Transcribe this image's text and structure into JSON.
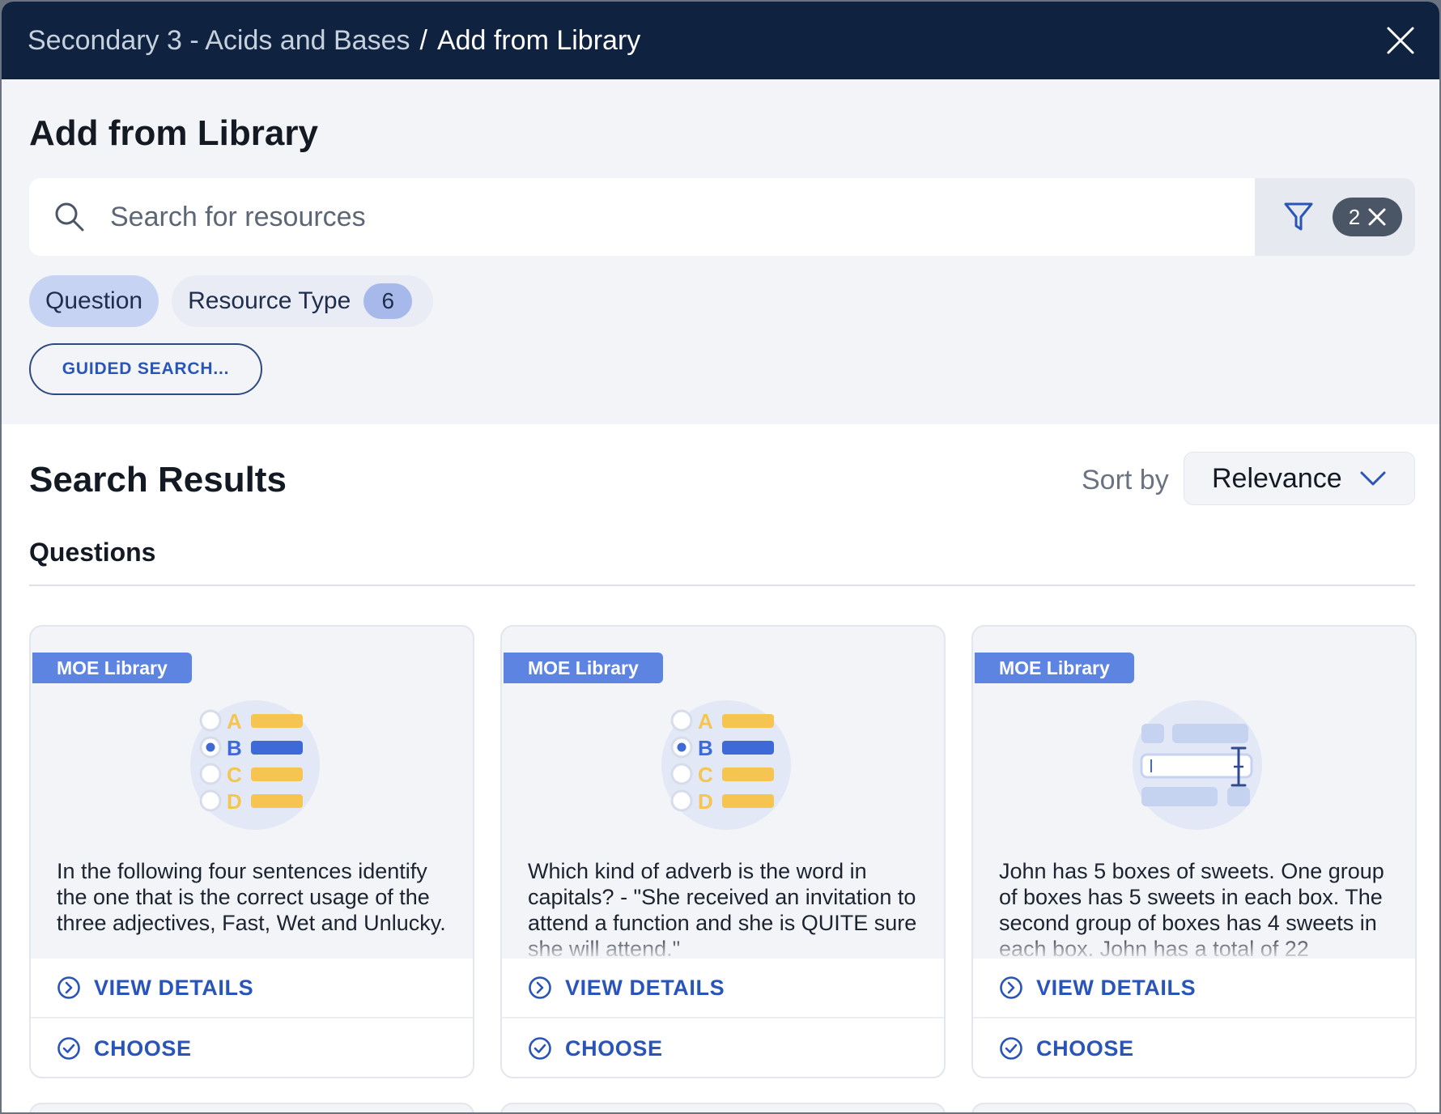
{
  "breadcrumb": {
    "parent": "Secondary 3 - Acids and Bases",
    "separator": "/",
    "current": "Add from Library"
  },
  "page_title": "Add from Library",
  "search": {
    "placeholder": "Search for resources",
    "value": ""
  },
  "filter": {
    "active_count": "2"
  },
  "chips": [
    {
      "label": "Question",
      "active": true
    },
    {
      "label": "Resource Type",
      "badge": "6",
      "active": false
    }
  ],
  "guided_search_label": "GUIDED SEARCH...",
  "results": {
    "heading": "Search Results",
    "sort_label": "Sort by",
    "sort_value": "Relevance",
    "section_label": "Questions"
  },
  "cards": [
    {
      "tag": "MOE Library",
      "illustration": "multiple-choice",
      "options": [
        "A",
        "B",
        "C",
        "D"
      ],
      "text": "In the following four sentences identify the one that is the correct usage of the three adjectives, Fast, Wet and Unlucky.",
      "view_label": "VIEW DETAILS",
      "choose_label": "CHOOSE"
    },
    {
      "tag": "MOE Library",
      "illustration": "multiple-choice",
      "options": [
        "A",
        "B",
        "C",
        "D"
      ],
      "text": "Which kind of adverb is the word in capitals? - \"She received an invitation to attend a function and she is QUITE sure she will attend.\"",
      "view_label": "VIEW DETAILS",
      "choose_label": "CHOOSE"
    },
    {
      "tag": "MOE Library",
      "illustration": "fill-in-blank",
      "text": "John has 5 boxes of sweets. One group of boxes has 5 sweets in each box. The second group of boxes has 4 sweets in each box. John has a total of 22",
      "view_label": "VIEW DETAILS",
      "choose_label": "CHOOSE"
    }
  ],
  "colors": {
    "header_bg": "#0f2340",
    "accent": "#2a55b8",
    "tag_bg": "#5d84e0",
    "option_yellow": "#f5c451",
    "option_blue": "#3d6ad6"
  }
}
